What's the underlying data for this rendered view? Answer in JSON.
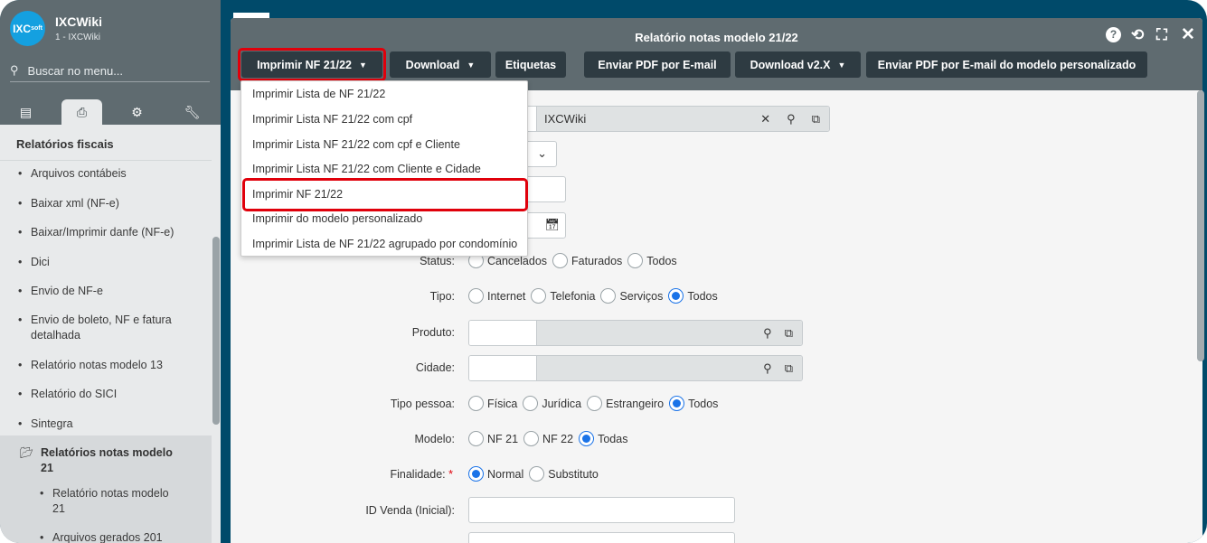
{
  "sidebar": {
    "logo_text": "IXCsoft",
    "workspace_name": "IXCWiki",
    "workspace_sub": "1 - IXCWiki",
    "search_placeholder": "Buscar no menu...",
    "tabs": [
      "list-icon",
      "printer-icon",
      "gears-icon",
      "wrench-icon"
    ],
    "active_tab": 1,
    "section_title": "Relatórios fiscais",
    "items": [
      "Arquivos contábeis",
      "Baixar xml (NF-e)",
      "Baixar/Imprimir danfe (NF-e)",
      "Dici",
      "Envio de NF-e",
      "Envio de boleto, NF e fatura detalhada",
      "Relatório notas modelo 13",
      "Relatório do SICI",
      "Sintegra"
    ],
    "open_folder": "Relatórios notas modelo 21",
    "sub_items": [
      "Relatório notas modelo 21",
      "Arquivos gerados 201"
    ]
  },
  "modal": {
    "title": "Relatório notas modelo 21/22",
    "header_icons": [
      "help-icon",
      "history-icon",
      "fullscreen-icon",
      "close-icon"
    ],
    "buttons": {
      "print": "Imprimir NF 21/22",
      "download": "Download",
      "labels": "Etiquetas",
      "send_pdf": "Enviar PDF por E-mail",
      "download_v2": "Download v2.X",
      "send_pdf_custom": "Enviar PDF por E-mail do modelo personalizado"
    },
    "dropdown": [
      "Imprimir Lista de NF 21/22",
      "Imprimir Lista NF 21/22 com cpf",
      "Imprimir Lista NF 21/22 com cpf e Cliente",
      "Imprimir Lista NF 21/22 com Cliente e Cidade",
      "Imprimir NF 21/22",
      "Imprimir do modelo personalizado",
      "Imprimir Lista de NF 21/22 agrupado por condomínio"
    ],
    "highlighted_item": "Imprimir NF 21/22",
    "highlight_color": "#e0000b"
  },
  "form": {
    "company_value": "IXCWiki",
    "status": {
      "label": "Status:",
      "options": [
        "Cancelados",
        "Faturados",
        "Todos"
      ],
      "selected": null
    },
    "tipo": {
      "label": "Tipo:",
      "options": [
        "Internet",
        "Telefonia",
        "Serviços",
        "Todos"
      ],
      "selected": "Todos"
    },
    "produto": {
      "label": "Produto:"
    },
    "cidade": {
      "label": "Cidade:"
    },
    "tipo_pessoa": {
      "label": "Tipo pessoa:",
      "options": [
        "Física",
        "Jurídica",
        "Estrangeiro",
        "Todos"
      ],
      "selected": "Todos"
    },
    "modelo": {
      "label": "Modelo:",
      "options": [
        "NF 21",
        "NF 22",
        "Todas"
      ],
      "selected": "Todas"
    },
    "finalidade": {
      "label": "Finalidade:",
      "required": "*",
      "options": [
        "Normal",
        "Substituto"
      ],
      "selected": "Normal"
    },
    "id_venda_inicial": {
      "label": "ID Venda (Inicial):",
      "value": ""
    }
  }
}
